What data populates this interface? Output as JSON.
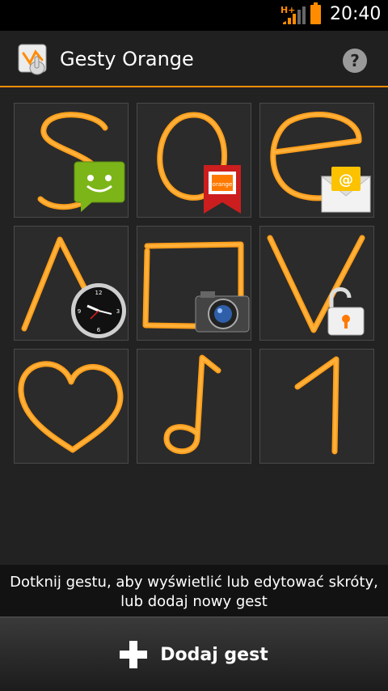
{
  "status_bar": {
    "network_type": "H+",
    "time": "20:40",
    "accent_color": "#ff8c00"
  },
  "action_bar": {
    "title": "Gesty Orange",
    "help_label": "?"
  },
  "gestures": [
    {
      "shape": "S",
      "shortcut_icon": "messaging-icon"
    },
    {
      "shape": "O",
      "shortcut_icon": "orange-bookmark-icon"
    },
    {
      "shape": "e",
      "shortcut_icon": "email-icon"
    },
    {
      "shape": "Λ",
      "shortcut_icon": "clock-icon"
    },
    {
      "shape": "□",
      "shortcut_icon": "camera-icon"
    },
    {
      "shape": "V",
      "shortcut_icon": "unlock-icon"
    },
    {
      "shape": "heart",
      "shortcut_icon": ""
    },
    {
      "shape": "note",
      "shortcut_icon": ""
    },
    {
      "shape": "1",
      "shortcut_icon": ""
    }
  ],
  "hint": {
    "text": "Dotknij gestu, aby wyświetlić lub edytować skróty, lub dodaj nowy gest"
  },
  "bottom_bar": {
    "add_label": "Dodaj gest"
  },
  "colors": {
    "gesture_stroke": "#ff9f1a",
    "background": "#222222",
    "tile_background": "#2b2b2b"
  }
}
